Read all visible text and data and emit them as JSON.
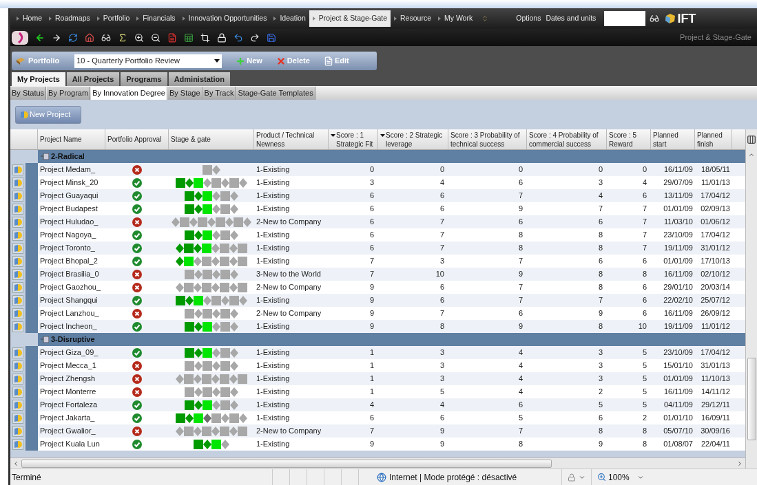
{
  "nav": {
    "items": [
      {
        "label": "Home",
        "selected": false
      },
      {
        "label": "Roadmaps",
        "selected": false
      },
      {
        "label": "Portfolio",
        "selected": false
      },
      {
        "label": "Financials",
        "selected": false
      },
      {
        "label": "Innovation Opportunities",
        "selected": false
      },
      {
        "label": "Ideation",
        "selected": false
      },
      {
        "label": "Project & Stage-Gate",
        "selected": true
      },
      {
        "label": "Resource",
        "selected": false
      },
      {
        "label": "My Work",
        "selected": false
      }
    ],
    "links": [
      "Options",
      "Dates and units"
    ],
    "logo": "IFT"
  },
  "toolbar": {
    "caption": "Project & Stage-Gate"
  },
  "portfolio_bar": {
    "label": "Portfolio",
    "select_value": "10 - Quarterly Portfolio Review",
    "buttons": [
      {
        "kind": "new",
        "label": "New"
      },
      {
        "kind": "delete",
        "label": "Delete"
      },
      {
        "kind": "edit",
        "label": "Edit"
      }
    ]
  },
  "tabs": [
    {
      "label": "My Projects",
      "selected": true
    },
    {
      "label": "All Projects",
      "selected": false
    },
    {
      "label": "Programs",
      "selected": false
    },
    {
      "label": "Administation",
      "selected": false
    }
  ],
  "subtabs": [
    {
      "label": "By Status",
      "selected": false
    },
    {
      "label": "By Program",
      "selected": false
    },
    {
      "label": "By Innovation Degree",
      "selected": true
    },
    {
      "label": "By Stage",
      "selected": false
    },
    {
      "label": "By Track",
      "selected": false
    },
    {
      "label": "Stage-Gate Templates",
      "selected": false
    }
  ],
  "new_project_button": "New Project",
  "table": {
    "columns": [
      {
        "label": "Project Name",
        "sorted": false
      },
      {
        "label": "Portfolio Approval",
        "sorted": false
      },
      {
        "label": "Stage & gate",
        "sorted": false
      },
      {
        "label": "Product / Technical Newness",
        "sorted": false
      },
      {
        "label": "Score : 1 Strategic Fit",
        "sorted": true
      },
      {
        "label": "Score : 2 Strategic leverage",
        "sorted": true
      },
      {
        "label": "Score : 3 Probability of technical success",
        "sorted": false
      },
      {
        "label": "Score : 4 Probability of commercial success",
        "sorted": false
      },
      {
        "label": "Score : 5 Reward",
        "sorted": false
      },
      {
        "label": "Planned start",
        "sorted": false
      },
      {
        "label": "Planned finish",
        "sorted": false
      }
    ],
    "groups": [
      {
        "label": "2-Radical",
        "rows": [
          {
            "name": "Project Medam_",
            "approved": false,
            "stages": [
              {
                "kind": "stage",
                "color": "#a8a8a8"
              },
              {
                "kind": "gate",
                "color": "#a8a8a8"
              }
            ],
            "newness": "1-Existing",
            "scores": [
              "0",
              "0",
              "0",
              "0",
              "0"
            ],
            "start": "16/11/09",
            "finish": "18/05/11"
          },
          {
            "name": "Project Minsk_20",
            "approved": true,
            "stages": [
              {
                "kind": "stage",
                "color": "#009a00"
              },
              {
                "kind": "gate",
                "color": "#009a00"
              },
              {
                "kind": "stage",
                "color": "#00e600"
              },
              {
                "kind": "gate",
                "color": "#a8a8a8"
              },
              {
                "kind": "stage",
                "color": "#a8a8a8"
              },
              {
                "kind": "gate",
                "color": "#a8a8a8"
              },
              {
                "kind": "stage",
                "color": "#a8a8a8"
              },
              {
                "kind": "gate",
                "color": "#a8a8a8"
              }
            ],
            "newness": "1-Existing",
            "scores": [
              "3",
              "4",
              "6",
              "3",
              "4"
            ],
            "start": "29/07/09",
            "finish": "11/01/13"
          },
          {
            "name": "Project Guayaqui",
            "approved": true,
            "stages": [
              {
                "kind": "stage",
                "color": "#009a00"
              },
              {
                "kind": "gate",
                "color": "#009a00"
              },
              {
                "kind": "stage",
                "color": "#00e600"
              },
              {
                "kind": "gate",
                "color": "#a8a8a8"
              },
              {
                "kind": "stage",
                "color": "#a8a8a8"
              },
              {
                "kind": "gate",
                "color": "#a8a8a8"
              }
            ],
            "newness": "1-Existing",
            "scores": [
              "6",
              "6",
              "7",
              "4",
              "6"
            ],
            "start": "13/11/09",
            "finish": "17/04/12"
          },
          {
            "name": "Project Budapest",
            "approved": true,
            "stages": [
              {
                "kind": "stage",
                "color": "#009a00"
              },
              {
                "kind": "gate",
                "color": "#009a00"
              },
              {
                "kind": "stage",
                "color": "#00e600"
              },
              {
                "kind": "gate",
                "color": "#a8a8a8"
              },
              {
                "kind": "stage",
                "color": "#a8a8a8"
              },
              {
                "kind": "gate",
                "color": "#a8a8a8"
              }
            ],
            "newness": "1-Existing",
            "scores": [
              "6",
              "6",
              "9",
              "7",
              "7"
            ],
            "start": "01/01/09",
            "finish": "02/09/13"
          },
          {
            "name": "Project Huludao_",
            "approved": false,
            "stages": [
              {
                "kind": "gate",
                "color": "#a8a8a8"
              },
              {
                "kind": "stage",
                "color": "#a8a8a8"
              },
              {
                "kind": "gate",
                "color": "#a8a8a8"
              },
              {
                "kind": "stage",
                "color": "#a8a8a8"
              },
              {
                "kind": "gate",
                "color": "#a8a8a8"
              },
              {
                "kind": "stage",
                "color": "#a8a8a8"
              },
              {
                "kind": "gate",
                "color": "#a8a8a8"
              },
              {
                "kind": "stage",
                "color": "#a8a8a8"
              },
              {
                "kind": "gate",
                "color": "#a8a8a8"
              }
            ],
            "newness": "2-New to Company",
            "scores": [
              "6",
              "7",
              "6",
              "6",
              "7"
            ],
            "start": "11/03/10",
            "finish": "01/06/12"
          },
          {
            "name": "Project Nagoya_",
            "approved": true,
            "stages": [
              {
                "kind": "stage",
                "color": "#009a00"
              },
              {
                "kind": "gate",
                "color": "#009a00"
              },
              {
                "kind": "stage",
                "color": "#00e600"
              },
              {
                "kind": "gate",
                "color": "#a8a8a8"
              },
              {
                "kind": "stage",
                "color": "#a8a8a8"
              },
              {
                "kind": "gate",
                "color": "#a8a8a8"
              }
            ],
            "newness": "1-Existing",
            "scores": [
              "6",
              "7",
              "8",
              "8",
              "7"
            ],
            "start": "23/10/09",
            "finish": "17/04/12"
          },
          {
            "name": "Project Toronto_",
            "approved": true,
            "stages": [
              {
                "kind": "gate",
                "color": "#009a00"
              },
              {
                "kind": "stage",
                "color": "#009a00"
              },
              {
                "kind": "gate",
                "color": "#009a00"
              },
              {
                "kind": "stage",
                "color": "#00e600"
              },
              {
                "kind": "gate",
                "color": "#a8a8a8"
              },
              {
                "kind": "stage",
                "color": "#a8a8a8"
              },
              {
                "kind": "gate",
                "color": "#a8a8a8"
              },
              {
                "kind": "stage",
                "color": "#a8a8a8"
              }
            ],
            "newness": "1-Existing",
            "scores": [
              "6",
              "7",
              "8",
              "8",
              "7"
            ],
            "start": "19/11/09",
            "finish": "31/01/12"
          },
          {
            "name": "Project Bhopal_2",
            "approved": true,
            "stages": [
              {
                "kind": "gate",
                "color": "#009a00"
              },
              {
                "kind": "stage",
                "color": "#00e600"
              },
              {
                "kind": "gate",
                "color": "#a8a8a8"
              },
              {
                "kind": "stage",
                "color": "#a8a8a8"
              },
              {
                "kind": "gate",
                "color": "#a8a8a8"
              },
              {
                "kind": "stage",
                "color": "#a8a8a8"
              },
              {
                "kind": "gate",
                "color": "#a8a8a8"
              },
              {
                "kind": "stage",
                "color": "#a8a8a8"
              }
            ],
            "newness": "1-Existing",
            "scores": [
              "7",
              "3",
              "7",
              "6",
              "6"
            ],
            "start": "01/01/09",
            "finish": "17/10/13"
          },
          {
            "name": "Project Brasilia_0",
            "approved": false,
            "stages": [
              {
                "kind": "stage",
                "color": "#a8a8a8"
              },
              {
                "kind": "gate",
                "color": "#a8a8a8"
              },
              {
                "kind": "stage",
                "color": "#a8a8a8"
              },
              {
                "kind": "gate",
                "color": "#a8a8a8"
              },
              {
                "kind": "stage",
                "color": "#a8a8a8"
              },
              {
                "kind": "gate",
                "color": "#a8a8a8"
              }
            ],
            "newness": "3-New to the World",
            "scores": [
              "7",
              "10",
              "9",
              "8",
              "8"
            ],
            "start": "16/11/09",
            "finish": "02/10/12"
          },
          {
            "name": "Project Gaozhou_",
            "approved": false,
            "stages": [
              {
                "kind": "gate",
                "color": "#a8a8a8"
              },
              {
                "kind": "stage",
                "color": "#a8a8a8"
              },
              {
                "kind": "gate",
                "color": "#a8a8a8"
              },
              {
                "kind": "stage",
                "color": "#a8a8a8"
              },
              {
                "kind": "gate",
                "color": "#a8a8a8"
              },
              {
                "kind": "stage",
                "color": "#a8a8a8"
              },
              {
                "kind": "gate",
                "color": "#a8a8a8"
              },
              {
                "kind": "stage",
                "color": "#a8a8a8"
              }
            ],
            "newness": "2-New to Company",
            "scores": [
              "9",
              "6",
              "7",
              "8",
              "6"
            ],
            "start": "29/01/10",
            "finish": "20/03/14"
          },
          {
            "name": "Project Shangqui",
            "approved": true,
            "stages": [
              {
                "kind": "stage",
                "color": "#009a00"
              },
              {
                "kind": "gate",
                "color": "#009a00"
              },
              {
                "kind": "stage",
                "color": "#00e600"
              },
              {
                "kind": "gate",
                "color": "#a8a8a8"
              },
              {
                "kind": "stage",
                "color": "#a8a8a8"
              },
              {
                "kind": "gate",
                "color": "#a8a8a8"
              },
              {
                "kind": "stage",
                "color": "#a8a8a8"
              },
              {
                "kind": "gate",
                "color": "#a8a8a8"
              }
            ],
            "newness": "1-Existing",
            "scores": [
              "9",
              "6",
              "7",
              "7",
              "6"
            ],
            "start": "22/02/10",
            "finish": "25/07/12"
          },
          {
            "name": "Project Lanzhou_",
            "approved": false,
            "stages": [
              {
                "kind": "stage",
                "color": "#a8a8a8"
              },
              {
                "kind": "gate",
                "color": "#a8a8a8"
              },
              {
                "kind": "stage",
                "color": "#a8a8a8"
              },
              {
                "kind": "gate",
                "color": "#a8a8a8"
              },
              {
                "kind": "stage",
                "color": "#a8a8a8"
              },
              {
                "kind": "gate",
                "color": "#a8a8a8"
              }
            ],
            "newness": "2-New to Company",
            "scores": [
              "9",
              "7",
              "6",
              "9",
              "6"
            ],
            "start": "16/11/09",
            "finish": "26/09/12"
          },
          {
            "name": "Project Incheon_",
            "approved": true,
            "stages": [
              {
                "kind": "stage",
                "color": "#009a00"
              },
              {
                "kind": "gate",
                "color": "#009a00"
              },
              {
                "kind": "stage",
                "color": "#00e600"
              },
              {
                "kind": "gate",
                "color": "#a8a8a8"
              },
              {
                "kind": "stage",
                "color": "#a8a8a8"
              },
              {
                "kind": "gate",
                "color": "#a8a8a8"
              }
            ],
            "newness": "1-Existing",
            "scores": [
              "9",
              "8",
              "9",
              "8",
              "10"
            ],
            "start": "19/11/09",
            "finish": "11/01/12"
          }
        ]
      },
      {
        "label": "3-Disruptive",
        "rows": [
          {
            "name": "Project Giza_09_",
            "approved": true,
            "stages": [
              {
                "kind": "stage",
                "color": "#009a00"
              },
              {
                "kind": "gate",
                "color": "#009a00"
              },
              {
                "kind": "stage",
                "color": "#00e600"
              },
              {
                "kind": "gate",
                "color": "#a8a8a8"
              },
              {
                "kind": "stage",
                "color": "#a8a8a8"
              },
              {
                "kind": "gate",
                "color": "#a8a8a8"
              }
            ],
            "newness": "1-Existing",
            "scores": [
              "1",
              "3",
              "4",
              "3",
              "5"
            ],
            "start": "23/10/09",
            "finish": "17/04/12"
          },
          {
            "name": "Project Mecca_1",
            "approved": false,
            "stages": [
              {
                "kind": "stage",
                "color": "#a8a8a8"
              },
              {
                "kind": "gate",
                "color": "#a8a8a8"
              },
              {
                "kind": "stage",
                "color": "#a8a8a8"
              },
              {
                "kind": "gate",
                "color": "#a8a8a8"
              },
              {
                "kind": "stage",
                "color": "#a8a8a8"
              },
              {
                "kind": "gate",
                "color": "#a8a8a8"
              }
            ],
            "newness": "1-Existing",
            "scores": [
              "1",
              "3",
              "4",
              "3",
              "5"
            ],
            "start": "15/01/10",
            "finish": "31/01/13"
          },
          {
            "name": "Project Zhengsh",
            "approved": false,
            "stages": [
              {
                "kind": "gate",
                "color": "#a8a8a8"
              },
              {
                "kind": "stage",
                "color": "#a8a8a8"
              },
              {
                "kind": "gate",
                "color": "#a8a8a8"
              },
              {
                "kind": "stage",
                "color": "#a8a8a8"
              },
              {
                "kind": "gate",
                "color": "#a8a8a8"
              },
              {
                "kind": "stage",
                "color": "#a8a8a8"
              },
              {
                "kind": "gate",
                "color": "#a8a8a8"
              },
              {
                "kind": "stage",
                "color": "#a8a8a8"
              }
            ],
            "newness": "1-Existing",
            "scores": [
              "1",
              "3",
              "4",
              "3",
              "5"
            ],
            "start": "01/01/09",
            "finish": "11/10/13"
          },
          {
            "name": "Project Monterre",
            "approved": false,
            "stages": [
              {
                "kind": "stage",
                "color": "#a8a8a8"
              },
              {
                "kind": "gate",
                "color": "#a8a8a8"
              },
              {
                "kind": "stage",
                "color": "#a8a8a8"
              },
              {
                "kind": "gate",
                "color": "#a8a8a8"
              },
              {
                "kind": "stage",
                "color": "#a8a8a8"
              },
              {
                "kind": "gate",
                "color": "#a8a8a8"
              }
            ],
            "newness": "1-Existing",
            "scores": [
              "1",
              "5",
              "4",
              "2",
              "5"
            ],
            "start": "16/11/09",
            "finish": "14/11/12"
          },
          {
            "name": "Project Fortaleza",
            "approved": true,
            "stages": [
              {
                "kind": "stage",
                "color": "#009a00"
              },
              {
                "kind": "gate",
                "color": "#009a00"
              },
              {
                "kind": "stage",
                "color": "#00e600"
              },
              {
                "kind": "gate",
                "color": "#a8a8a8"
              },
              {
                "kind": "stage",
                "color": "#a8a8a8"
              },
              {
                "kind": "gate",
                "color": "#a8a8a8"
              }
            ],
            "newness": "1-Existing",
            "scores": [
              "4",
              "4",
              "6",
              "5",
              "5"
            ],
            "start": "04/11/09",
            "finish": "29/12/11"
          },
          {
            "name": "Project Jakarta_",
            "approved": true,
            "stages": [
              {
                "kind": "stage",
                "color": "#009a00"
              },
              {
                "kind": "gate",
                "color": "#009a00"
              },
              {
                "kind": "stage",
                "color": "#00e600"
              },
              {
                "kind": "gate",
                "color": "#6e6e6e"
              },
              {
                "kind": "stage",
                "color": "#a8a8a8"
              },
              {
                "kind": "gate",
                "color": "#a8a8a8"
              },
              {
                "kind": "stage",
                "color": "#a8a8a8"
              },
              {
                "kind": "gate",
                "color": "#a8a8a8"
              }
            ],
            "newness": "1-Existing",
            "scores": [
              "6",
              "6",
              "5",
              "6",
              "2"
            ],
            "start": "01/01/10",
            "finish": "16/09/11"
          },
          {
            "name": "Project Gwalior_",
            "approved": false,
            "stages": [
              {
                "kind": "gate",
                "color": "#a8a8a8"
              },
              {
                "kind": "stage",
                "color": "#a8a8a8"
              },
              {
                "kind": "gate",
                "color": "#a8a8a8"
              },
              {
                "kind": "stage",
                "color": "#a8a8a8"
              },
              {
                "kind": "gate",
                "color": "#a8a8a8"
              },
              {
                "kind": "stage",
                "color": "#a8a8a8"
              },
              {
                "kind": "gate",
                "color": "#a8a8a8"
              },
              {
                "kind": "stage",
                "color": "#a8a8a8"
              }
            ],
            "newness": "2-New to Company",
            "scores": [
              "7",
              "9",
              "7",
              "8",
              "8"
            ],
            "start": "05/07/10",
            "finish": "30/09/16"
          },
          {
            "name": "Project Kuala Lun",
            "approved": true,
            "stages": [
              {
                "kind": "stage",
                "color": "#009a00"
              },
              {
                "kind": "gate",
                "color": "#009a00"
              },
              {
                "kind": "stage",
                "color": "#00e600"
              },
              {
                "kind": "gate",
                "color": "#a8a8a8"
              }
            ],
            "newness": "1-Existing",
            "scores": [
              "9",
              "9",
              "8",
              "9",
              "8"
            ],
            "start": "01/08/07",
            "finish": "22/04/11"
          }
        ]
      }
    ]
  },
  "status_bar": {
    "text": "Terminé",
    "zone": "Internet | Mode protégé : désactivé",
    "zoom": "100%"
  }
}
